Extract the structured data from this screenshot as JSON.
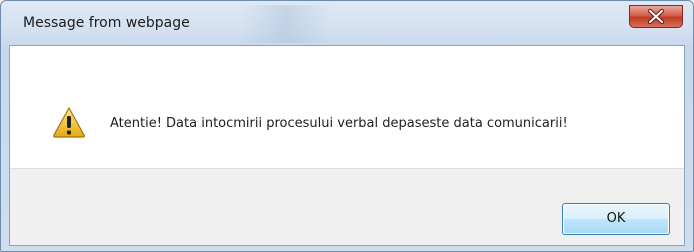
{
  "window": {
    "title": "Message from webpage",
    "close_icon": "close-icon"
  },
  "message": {
    "icon": "warning-icon",
    "text": "Atentie! Data intocmirii procesului verbal depaseste data comunicarii!"
  },
  "buttons": {
    "ok_label": "OK"
  },
  "colors": {
    "close_button": "#c23b22",
    "warning_icon": "#f2c12e"
  }
}
